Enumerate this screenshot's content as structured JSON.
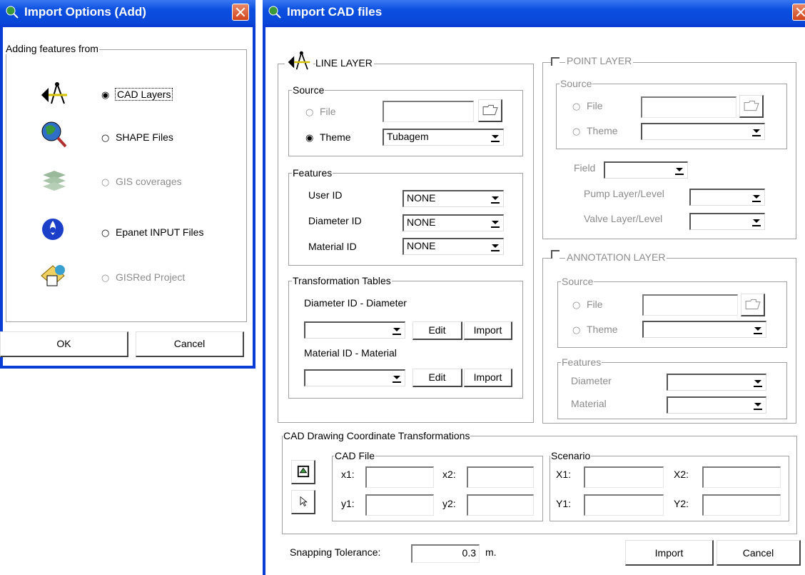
{
  "dialog1": {
    "title": "Import Options (Add)",
    "group_label": "Adding features from",
    "options": [
      {
        "label": "CAD Layers",
        "selected": true,
        "enabled": true,
        "icon": "cad-compass-icon"
      },
      {
        "label": "SHAPE Files",
        "selected": false,
        "enabled": true,
        "icon": "globe-magnifier-icon"
      },
      {
        "label": "GIS coverages",
        "selected": false,
        "enabled": false,
        "icon": "layers-stack-icon"
      },
      {
        "label": "Epanet INPUT Files",
        "selected": false,
        "enabled": true,
        "icon": "epanet-drop-icon"
      },
      {
        "label": "GISRed Project",
        "selected": false,
        "enabled": false,
        "icon": "gisred-project-icon"
      }
    ],
    "ok": "OK",
    "cancel": "Cancel"
  },
  "dialog2": {
    "title": "Import CAD files",
    "line_layer": {
      "label": "LINE LAYER",
      "source_label": "Source",
      "file_label": "File",
      "theme_label": "Theme",
      "theme_value": "Tubagem",
      "features_label": "Features",
      "user_id_label": "User ID",
      "user_id_value": "NONE",
      "diameter_id_label": "Diameter ID",
      "diameter_id_value": "NONE",
      "material_id_label": "Material ID",
      "material_id_value": "NONE",
      "tables_label": "Transformation Tables",
      "diam_table_label": "Diameter ID - Diameter",
      "mat_table_label": "Material ID - Material",
      "edit": "Edit",
      "import": "Import"
    },
    "point_layer": {
      "label": "POINT LAYER",
      "source_label": "Source",
      "file_label": "File",
      "theme_label": "Theme",
      "field_label": "Field",
      "pump_label": "Pump Layer/Level",
      "valve_label": "Valve Layer/Level"
    },
    "annotation_layer": {
      "label": "ANNOTATION LAYER",
      "source_label": "Source",
      "file_label": "File",
      "theme_label": "Theme",
      "features_label": "Features",
      "diameter_label": "Diameter",
      "material_label": "Material"
    },
    "coords": {
      "label": "CAD Drawing Coordinate Transformations",
      "cad_file_label": "CAD File",
      "scenario_label": "Scenario",
      "x1": "x1:",
      "x2": "x2:",
      "y1": "y1:",
      "y2": "y2:",
      "X1": "X1:",
      "X2": "X2:",
      "Y1": "Y1:",
      "Y2": "Y2:"
    },
    "snapping_label": "Snapping Tolerance:",
    "snapping_value": "0.3",
    "snapping_unit": "m.",
    "import_button": "Import",
    "cancel_button": "Cancel"
  }
}
